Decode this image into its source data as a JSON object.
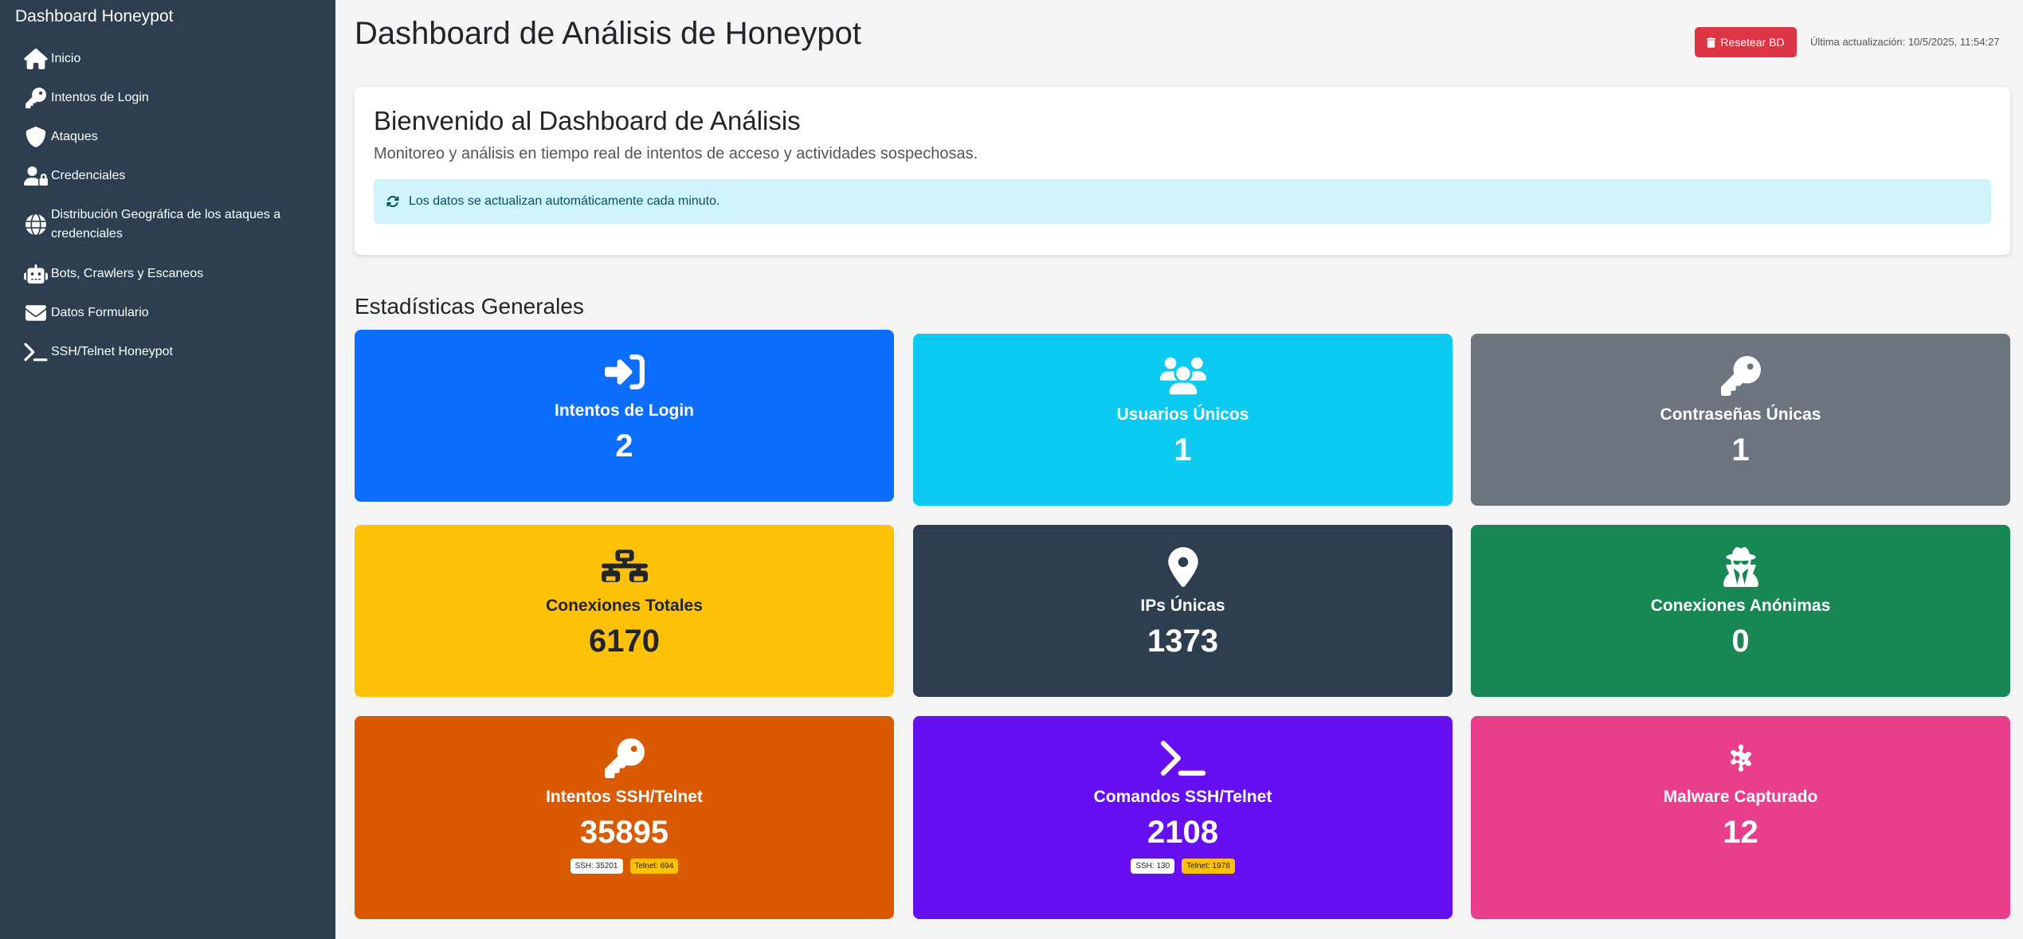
{
  "sidebar": {
    "brand": "Dashboard Honeypot",
    "items": [
      {
        "label": "Inicio",
        "icon": "home-icon"
      },
      {
        "label": "Intentos de Login",
        "icon": "key-icon"
      },
      {
        "label": "Ataques",
        "icon": "shield-icon"
      },
      {
        "label": "Credenciales",
        "icon": "user-lock-icon"
      },
      {
        "label": "Distribución Geográfica de los ataques a credenciales",
        "icon": "globe-icon"
      },
      {
        "label": "Bots, Crawlers y Escaneos",
        "icon": "robot-icon"
      },
      {
        "label": "Datos Formulario",
        "icon": "envelope-icon"
      },
      {
        "label": "SSH/Telnet Honeypot",
        "icon": "terminal-icon"
      }
    ]
  },
  "header": {
    "title": "Dashboard de Análisis de Honeypot",
    "reset_label": "Resetear BD",
    "last_update": "Última actualización: 10/5/2025, 11:54:27"
  },
  "welcome": {
    "title": "Bienvenido al Dashboard de Análisis",
    "subtitle": "Monitoreo y análisis en tiempo real de intentos de acceso y actividades sospechosas.",
    "alert": "Los datos se actualizan automáticamente cada minuto."
  },
  "stats": {
    "section_title": "Estadísticas Generales",
    "cards": [
      {
        "label": "Intentos de Login",
        "value": "2",
        "icon": "sign-in-icon",
        "color": "#0d6efd"
      },
      {
        "label": "Usuarios Únicos",
        "value": "1",
        "icon": "users-icon",
        "color": "#0dcaf0"
      },
      {
        "label": "Contraseñas Únicas",
        "value": "1",
        "icon": "key-icon",
        "color": "#6c757d"
      },
      {
        "label": "Conexiones Totales",
        "value": "6170",
        "icon": "network-icon",
        "color": "#ffc107"
      },
      {
        "label": "IPs Únicas",
        "value": "1373",
        "icon": "map-marker-icon",
        "color": "#2c3e50"
      },
      {
        "label": "Conexiones Anónimas",
        "value": "0",
        "icon": "spy-icon",
        "color": "#198754"
      },
      {
        "label": "Intentos SSH/Telnet",
        "value": "35895",
        "icon": "key-icon",
        "color": "#d95a00",
        "badge_ssh": "SSH: 35201",
        "badge_telnet": "Telnet: 694"
      },
      {
        "label": "Comandos SSH/Telnet",
        "value": "2108",
        "icon": "terminal-icon",
        "color": "#6610f2",
        "badge_ssh": "SSH: 130",
        "badge_telnet": "Telnet: 1978"
      },
      {
        "label": "Malware Capturado",
        "value": "12",
        "icon": "virus-icon",
        "color": "#e83e8c"
      }
    ]
  }
}
